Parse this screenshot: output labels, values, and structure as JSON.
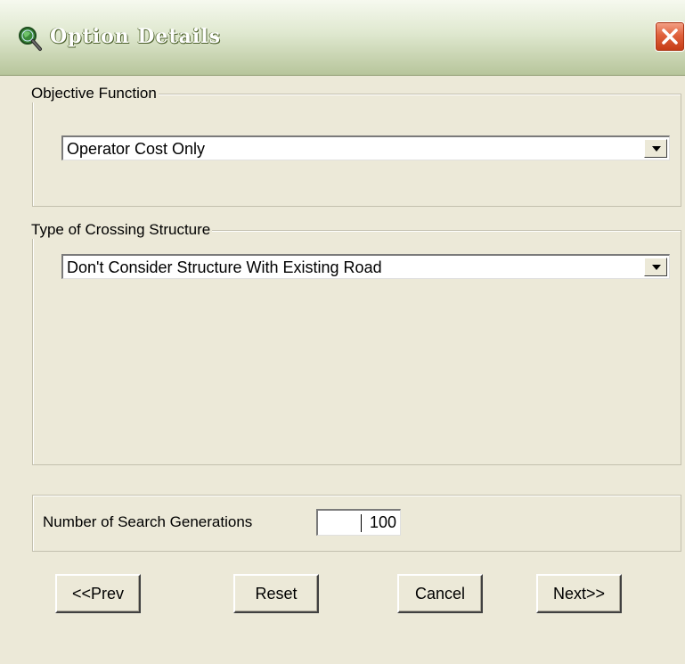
{
  "window": {
    "title": "Option Details",
    "icon": "search-globe-icon",
    "close_icon": "close-icon",
    "accent_colors": {
      "titlebar": "#b7c59b",
      "close": "#e0613c",
      "background": "#ece9d8"
    }
  },
  "objective": {
    "group_label": "Objective Function",
    "selected": "Operator Cost Only"
  },
  "crossing": {
    "group_label": "Type of Crossing Structure",
    "selected": "Don't Consider Structure With Existing Road"
  },
  "search": {
    "label": "Number of Search Generations",
    "value": "100"
  },
  "buttons": {
    "prev": "<<Prev",
    "reset": "Reset",
    "cancel": "Cancel",
    "next": "Next>>"
  }
}
